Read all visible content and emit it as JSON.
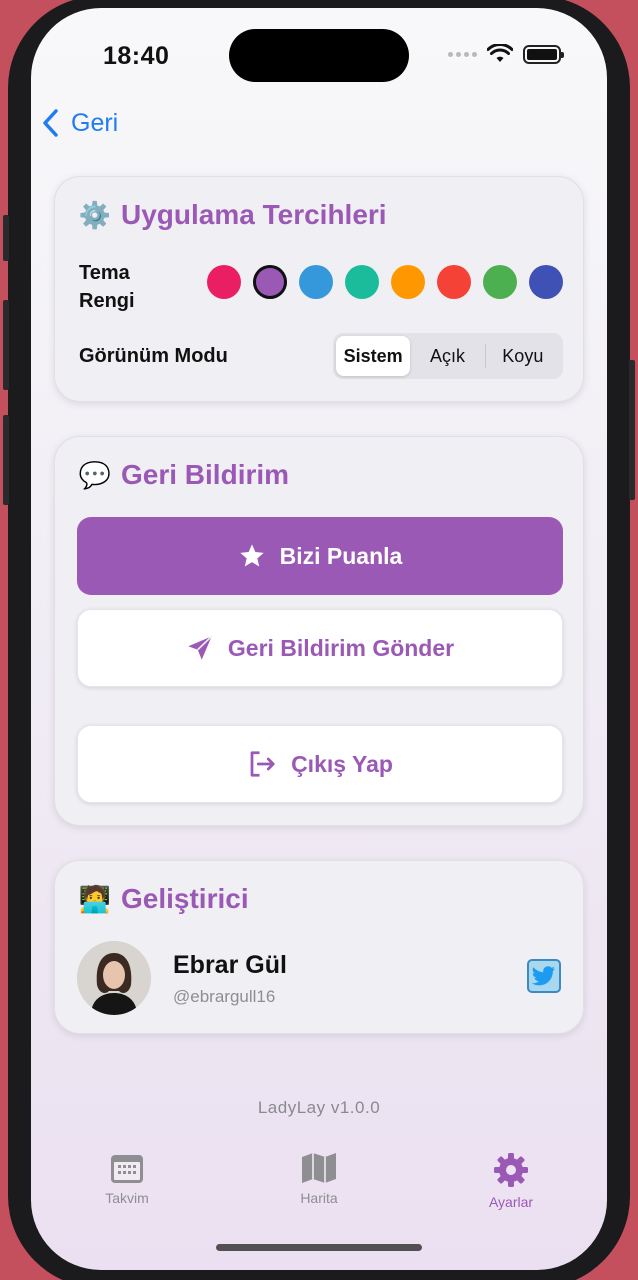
{
  "status": {
    "time": "18:40"
  },
  "nav": {
    "back_label": "Geri"
  },
  "prefs": {
    "title": "Uygulama Tercihleri",
    "icon": "gear-icon",
    "theme_label_line1": "Tema",
    "theme_label_line2": "Rengi",
    "theme_colors": [
      "#e91e63",
      "#9b59b6",
      "#3498db",
      "#1abc9c",
      "#ff9800",
      "#f44336",
      "#4caf50",
      "#3f51b5"
    ],
    "selected_color_index": 1,
    "mode_label": "Görünüm Modu",
    "modes": [
      "Sistem",
      "Açık",
      "Koyu"
    ],
    "selected_mode": "Sistem"
  },
  "feedback": {
    "title": "Geri Bildirim",
    "icon": "speech-bubble-icon",
    "rate_label": "Bizi Puanla",
    "send_label": "Geri Bildirim Gönder",
    "logout_label": "Çıkış Yap"
  },
  "developer": {
    "title": "Geliştirici",
    "icon": "technologist-icon",
    "name": "Ebrar Gül",
    "handle": "@ebrargull16"
  },
  "footer": {
    "version": "LadyLay v1.0.0"
  },
  "tabs": [
    {
      "label": "Takvim",
      "icon": "calendar-icon"
    },
    {
      "label": "Harita",
      "icon": "map-icon"
    },
    {
      "label": "Ayarlar",
      "icon": "gear-icon",
      "active": true
    }
  ],
  "colors": {
    "accent": "#9b59b6",
    "link": "#1f7cf2"
  }
}
